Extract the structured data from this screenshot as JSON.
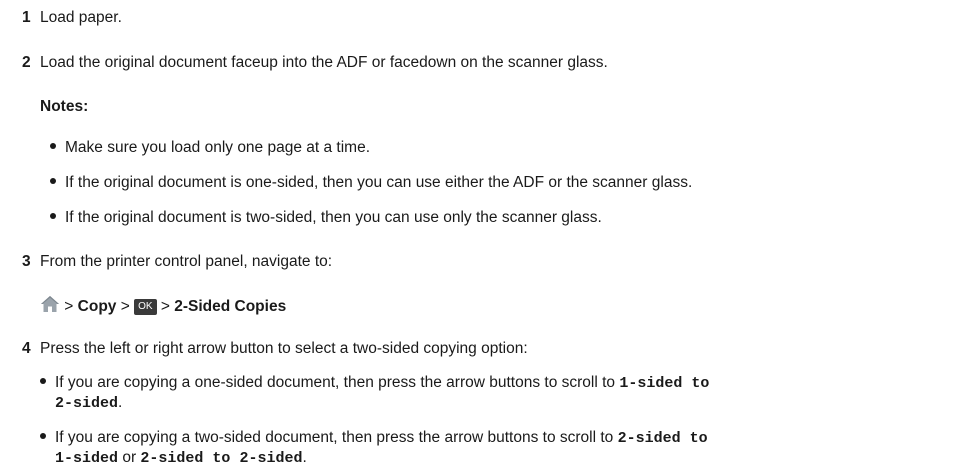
{
  "steps": [
    {
      "num": "1",
      "text": "Load paper."
    },
    {
      "num": "2",
      "text": "Load the original document faceup into the ADF or facedown on the scanner glass."
    },
    {
      "num": "3",
      "text": "From the printer control panel, navigate to:"
    },
    {
      "num": "4",
      "text": "Press the left or right arrow button to select a two-sided copying option:"
    }
  ],
  "notes": {
    "heading": "Notes:",
    "items": [
      "Make sure you load only one page at a time.",
      "If the original document is one-sided, then you can use either the ADF or the scanner glass.",
      "If the original document is two-sided, then you can use only the scanner glass."
    ]
  },
  "navigation": {
    "sep1": " > ",
    "copy": "Copy",
    "sep2": " > ",
    "ok": "OK",
    "sep3": " > ",
    "two_sided": "2-Sided Copies"
  },
  "options": {
    "one_sided_prefix": "If you are copying a one-sided document, then press the arrow buttons to scroll to ",
    "one_sided_value_a": "1-sided to",
    "one_sided_value_b": "2-sided",
    "one_sided_suffix": ".",
    "two_sided_prefix": "If you are copying a two-sided document, then press the arrow buttons to scroll to ",
    "two_sided_value_a": "2-sided to",
    "two_sided_value_b": "1-sided",
    "two_sided_or": " or ",
    "two_sided_value_c": "2-sided to 2-sided",
    "two_sided_suffix": "."
  },
  "colors": {
    "home_icon": "#9aa3ab",
    "ok_bg": "#3a3a3a"
  }
}
